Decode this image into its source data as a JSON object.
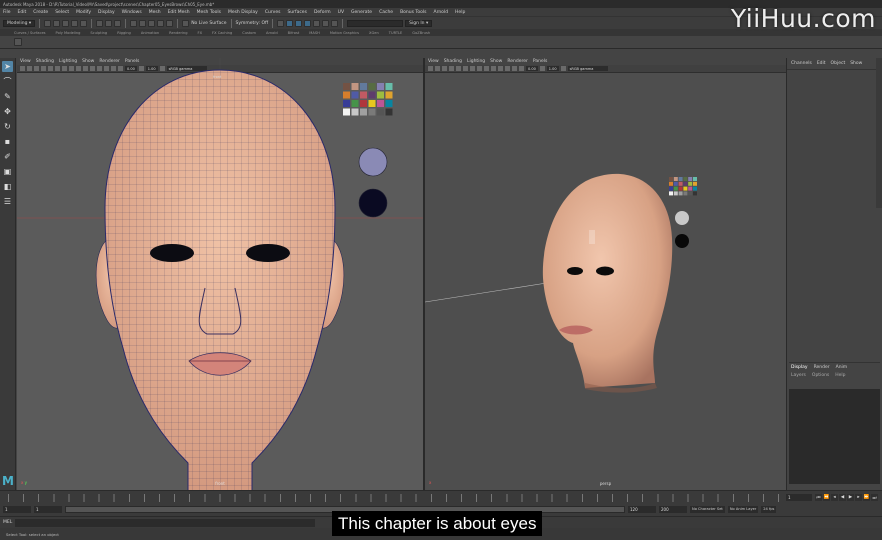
{
  "window": {
    "title": "Autodesk Maya 2018 - D:\\R\\Tutorial_Video\\Mr\\Saved\\project\\scenes\\Chapter05_EyesBrows\\Ch05_Eye.mb*"
  },
  "menubar": [
    "File",
    "Edit",
    "Create",
    "Select",
    "Modify",
    "Display",
    "Windows",
    "Mesh",
    "Edit Mesh",
    "Mesh Tools",
    "Mesh Display",
    "Curves",
    "Surfaces",
    "Deform",
    "UV",
    "Generate",
    "Cache",
    "Bonus Tools",
    "Arnold",
    "Help"
  ],
  "toolbar": {
    "menuset": "Modeling",
    "live_surface": "No Live Surface",
    "symmetry": "Symmetry: Off",
    "sign_in": "Sign In"
  },
  "shelf_tabs": [
    "Curves / Surfaces",
    "Poly Modeling",
    "Sculpting",
    "Rigging",
    "Animation",
    "Rendering",
    "FX",
    "FX Caching",
    "Custom",
    "Arnold",
    "Bifrost",
    "MASH",
    "Motion Graphics",
    "XGen",
    "TURTLE",
    "GoZBrush"
  ],
  "viewport_menu": [
    "View",
    "Shading",
    "Lighting",
    "Show",
    "Renderer",
    "Panels"
  ],
  "left_viewport": {
    "field_a": "0.00",
    "field_b": "1.00",
    "color_space": "sRGB gamma",
    "top_label": "front",
    "camera": "front"
  },
  "right_viewport": {
    "field_a": "0.00",
    "field_b": "1.00",
    "color_space": "sRGB gamma",
    "camera": "persp"
  },
  "channel_box": {
    "menu": [
      "Channels",
      "Edit",
      "Object",
      "Show"
    ]
  },
  "layer_editor": {
    "tabs": [
      "Display",
      "Render",
      "Anim"
    ],
    "menu": [
      "Layers",
      "Options",
      "Help"
    ]
  },
  "time_slider": {
    "current_frame": "1"
  },
  "range_slider": {
    "start": "1",
    "start_inner": "1",
    "end_inner": "120",
    "end": "200",
    "character_set": "No Character Set",
    "anim_layer": "No Anim Layer",
    "fps": "24 fps"
  },
  "command_line": {
    "label": "MEL"
  },
  "help_line": "Select Tool: select an object",
  "subtitle": "This chapter is about eyes",
  "watermark": "YiiHuu.com",
  "colors": {
    "viewport": "#5b5b5b",
    "skin": "#e7b49b",
    "wire": "#2a2a55",
    "accent": "#5285a6"
  }
}
